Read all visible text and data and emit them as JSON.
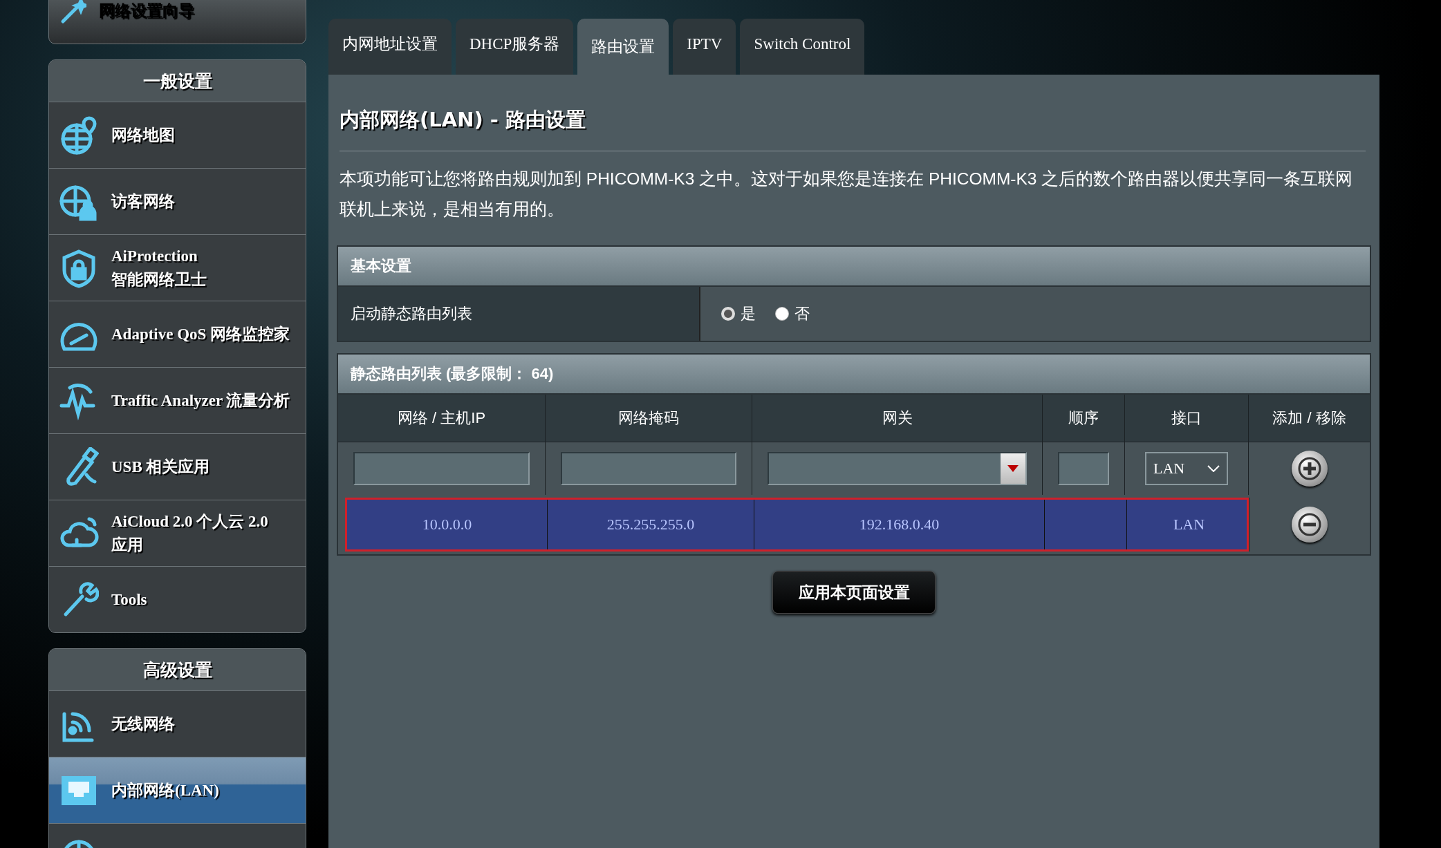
{
  "sidebar": {
    "top_item": {
      "label": "网络设置向导",
      "kind": "wizard"
    },
    "sections": [
      {
        "title": "一般设置",
        "items": [
          {
            "label": "网络地图",
            "kind": "map",
            "selected": false
          },
          {
            "label": "访客网络",
            "kind": "guest",
            "selected": false
          },
          {
            "label": "AiProtection\n智能网络卫士",
            "kind": "shield",
            "selected": false
          },
          {
            "label": "Adaptive QoS 网络监控家",
            "kind": "gauge",
            "selected": false
          },
          {
            "label": "Traffic Analyzer 流量分析",
            "kind": "traffic",
            "selected": false
          },
          {
            "label": "USB 相关应用",
            "kind": "usb",
            "selected": false
          },
          {
            "label": "AiCloud 2.0 个人云 2.0\n应用",
            "kind": "cloud",
            "selected": false
          },
          {
            "label": "Tools",
            "kind": "wrench",
            "selected": false
          }
        ]
      },
      {
        "title": "高级设置",
        "items": [
          {
            "label": "无线网络",
            "kind": "wireless",
            "selected": false
          },
          {
            "label": "内部网络(LAN)",
            "kind": "lan",
            "selected": true
          },
          {
            "kind": "globe",
            "selected": false
          }
        ]
      }
    ]
  },
  "tabs": [
    {
      "label": "内网地址设置",
      "selected": false
    },
    {
      "label": "DHCP服务器",
      "selected": false
    },
    {
      "label": "路由设置",
      "selected": true
    },
    {
      "label": "IPTV",
      "selected": false
    },
    {
      "label": "Switch Control",
      "selected": false
    }
  ],
  "page": {
    "title": "内部网络(LAN) - 路由设置",
    "description": "本项功能可让您将路由规则加到 PHICOMM-K3 之中。这对于如果您是连接在 PHICOMM-K3 之后的数个路由器以便共享同一条互联网联机上来说，是相当有用的。"
  },
  "basic_settings": {
    "title": "基本设置",
    "rows": [
      {
        "label": "启动静态路由列表",
        "options": [
          {
            "label": "是",
            "selected": true
          },
          {
            "label": "否",
            "selected": false
          }
        ]
      }
    ]
  },
  "route_list": {
    "title": "静态路由列表 (最多限制： 64)",
    "columns": [
      "网络 / 主机IP",
      "网络掩码",
      "网关",
      "顺序",
      "接口",
      "添加 / 移除"
    ],
    "input_row": {
      "interface": "LAN"
    },
    "rows": [
      {
        "network": "10.0.0.0",
        "netmask": "255.255.255.0",
        "gateway": "192.168.0.40",
        "interface": "LAN",
        "selected": true
      }
    ]
  },
  "apply_button": "应用本页面设置"
}
